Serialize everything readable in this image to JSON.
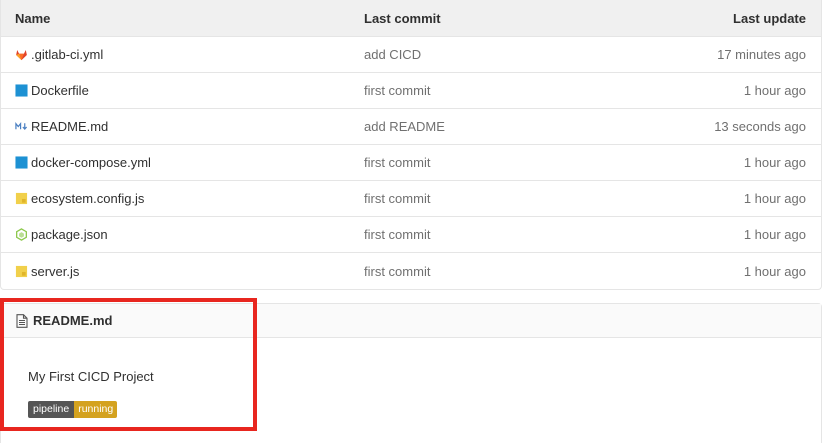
{
  "table": {
    "headers": {
      "name": "Name",
      "commit": "Last commit",
      "update": "Last update"
    },
    "rows": [
      {
        "name": ".gitlab-ci.yml",
        "commit": "add CICD",
        "update": "17 minutes ago",
        "icon": "gitlab-icon"
      },
      {
        "name": "Dockerfile",
        "commit": "first commit",
        "update": "1 hour ago",
        "icon": "docker-icon"
      },
      {
        "name": "README.md",
        "commit": "add README",
        "update": "13 seconds ago",
        "icon": "markdown-icon"
      },
      {
        "name": "docker-compose.yml",
        "commit": "first commit",
        "update": "1 hour ago",
        "icon": "docker-icon"
      },
      {
        "name": "ecosystem.config.js",
        "commit": "first commit",
        "update": "1 hour ago",
        "icon": "javascript-icon"
      },
      {
        "name": "package.json",
        "commit": "first commit",
        "update": "1 hour ago",
        "icon": "nodejs-icon"
      },
      {
        "name": "server.js",
        "commit": "first commit",
        "update": "1 hour ago",
        "icon": "javascript-icon"
      }
    ]
  },
  "readme": {
    "title": "README.md",
    "content": "My First CICD Project",
    "badge": {
      "label": "pipeline",
      "status": "running"
    }
  },
  "colors": {
    "highlight": "#e8261f",
    "badge_label_bg": "#555555",
    "badge_status_bg": "#d4a21f",
    "gitlab": "#e24329",
    "docker": "#1d91d3",
    "javascript": "#f1d04b",
    "nodejs": "#8cc84b",
    "markdown": "#4a7fc1"
  }
}
